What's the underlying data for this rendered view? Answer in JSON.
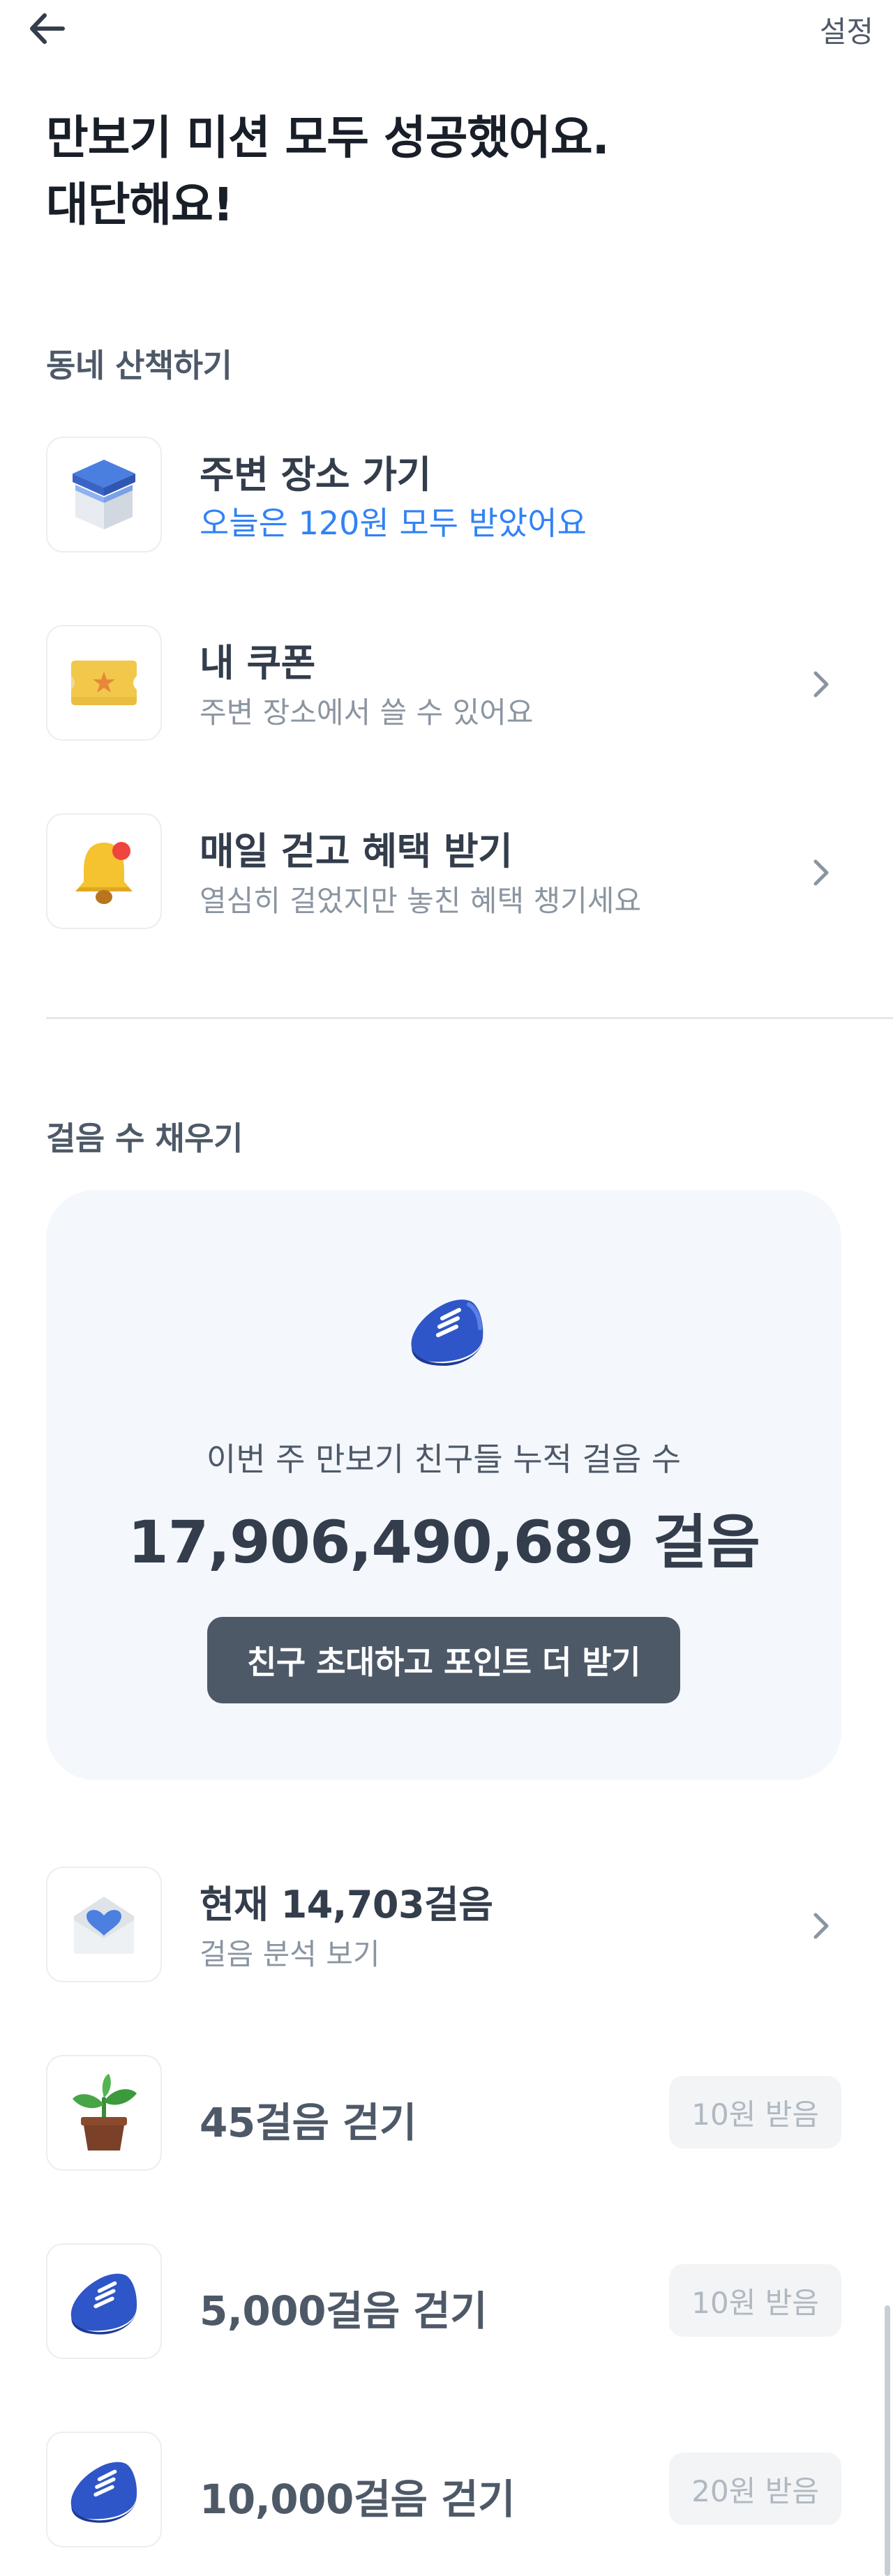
{
  "header": {
    "back_icon": "arrow-left-icon",
    "settings_label": "설정"
  },
  "headline": {
    "line1": "만보기 미션 모두 성공했어요.",
    "line2": "대단해요!"
  },
  "walk_section": {
    "title": "동네 산책하기",
    "items": [
      {
        "icon": "box-icon",
        "title": "주변 장소 가기",
        "subtitle": "오늘은 120원 모두 받았어요",
        "subtitle_color": "#3182f6"
      },
      {
        "icon": "coupon-icon",
        "title": "내 쿠폰",
        "subtitle": "주변 장소에서 쓸 수 있어요"
      },
      {
        "icon": "bell-icon",
        "title": "매일 걷고 혜택 받기",
        "subtitle": "열심히 걸었지만 놓친 혜택 챙기세요"
      }
    ]
  },
  "steps_section": {
    "title": "걸음 수 채우기",
    "card": {
      "icon": "sneaker-icon",
      "caption": "이번 주 만보기 친구들 누적 걸음 수",
      "count": "17,906,490,689 걸음",
      "button_label": "친구 초대하고 포인트 더 받기"
    },
    "current": {
      "icon": "envelope-heart-icon",
      "title": "현재 14,703걸음",
      "subtitle": "걸음 분석 보기"
    },
    "missions": [
      {
        "icon": "plant-icon",
        "title": "45걸음 걷기",
        "reward": "10원 받음"
      },
      {
        "icon": "sneaker-icon",
        "title": "5,000걸음 걷기",
        "reward": "10원 받음"
      },
      {
        "icon": "sneaker-icon",
        "title": "10,000걸음 걷기",
        "reward": "20원 받음"
      }
    ]
  },
  "colors": {
    "accent_blue": "#3182f6",
    "card_bg": "#f4f7fc",
    "button_bg": "#4e5968",
    "text_primary": "#333d4b",
    "text_secondary": "#8b95a1"
  }
}
